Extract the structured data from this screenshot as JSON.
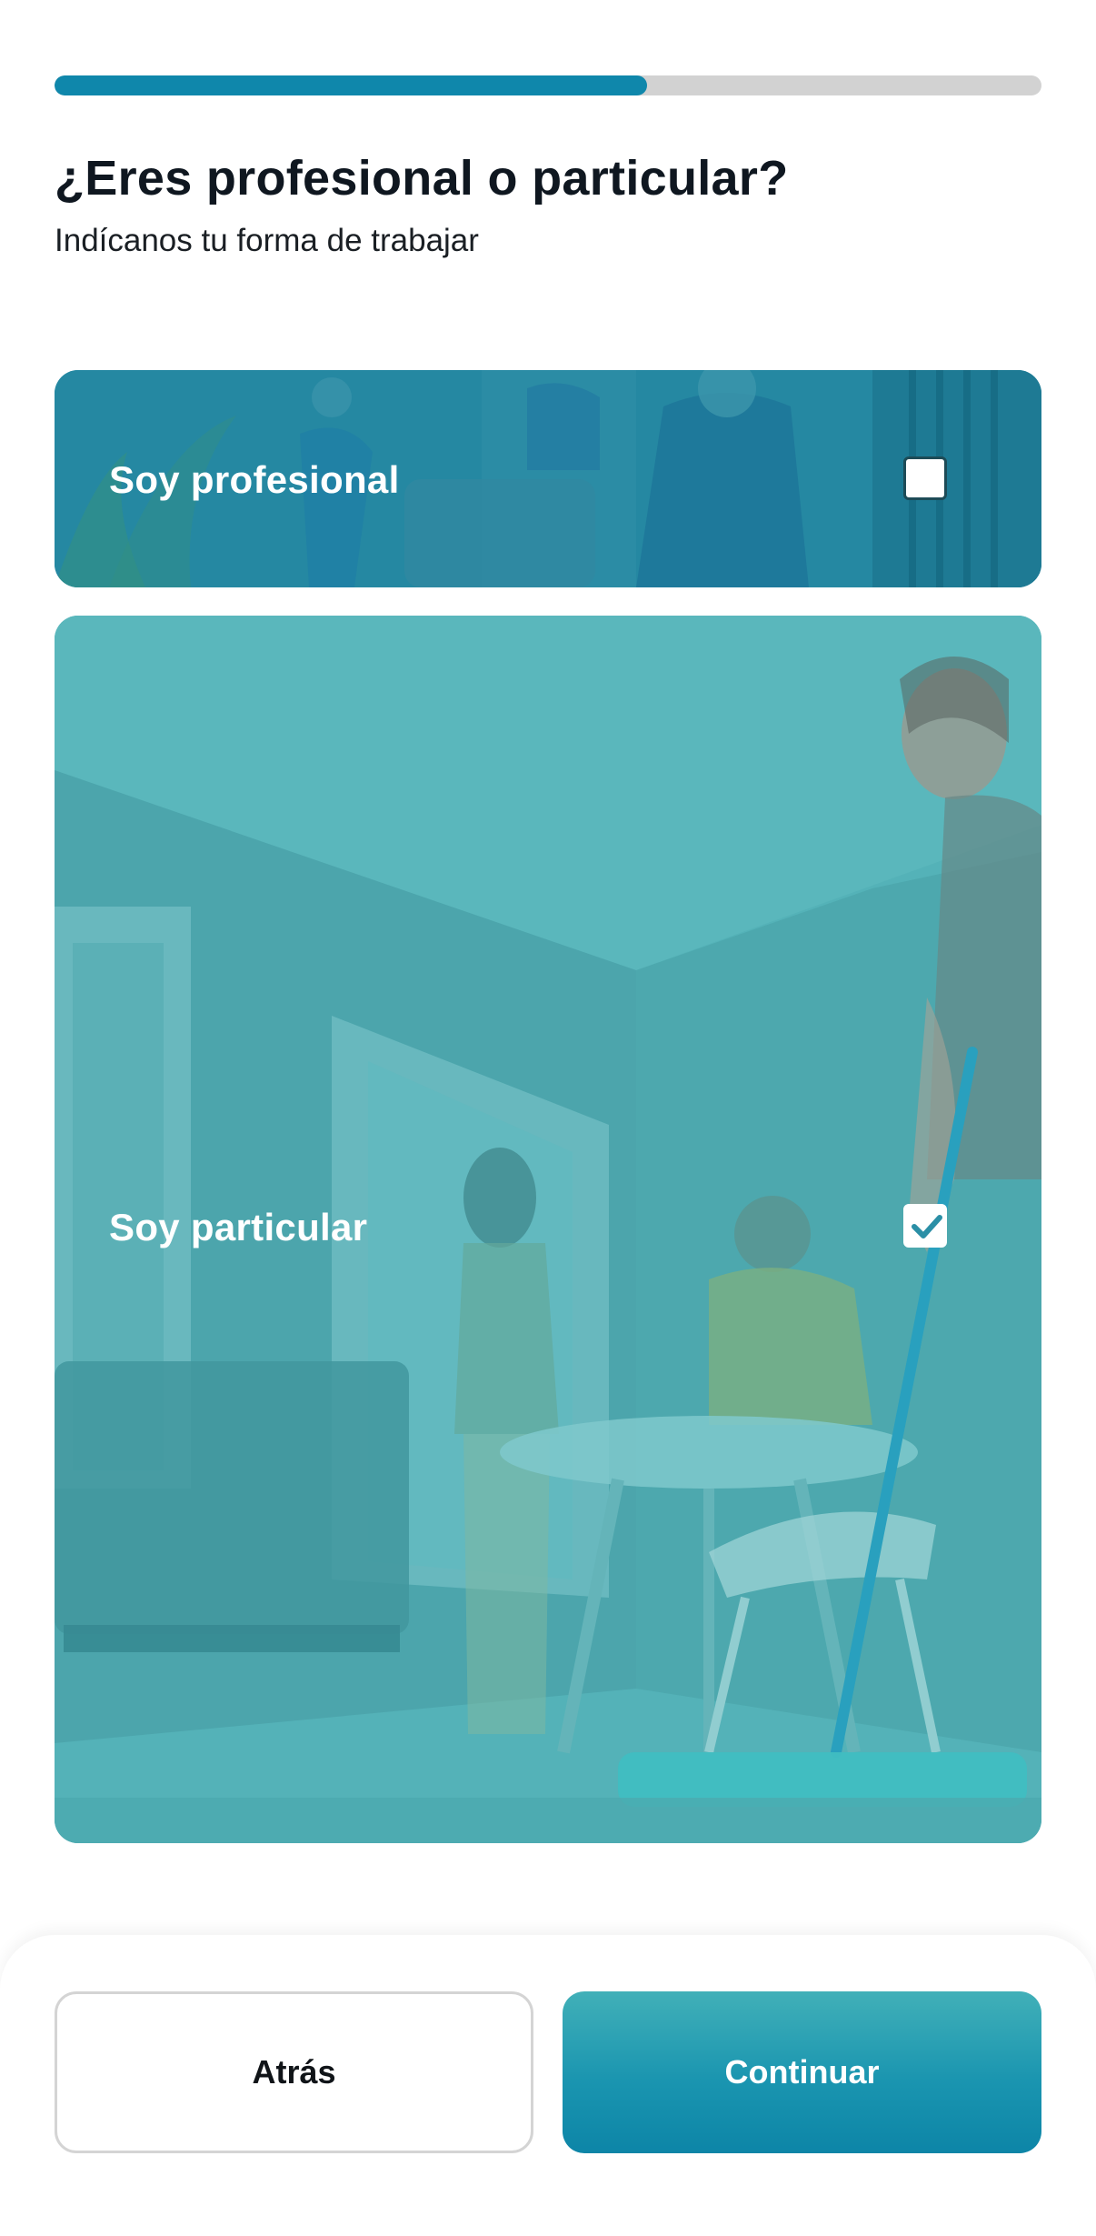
{
  "progress": {
    "value": 0.6
  },
  "header": {
    "title": "¿Eres profesional o particular?",
    "subtitle": "Indícanos tu forma de trabajar"
  },
  "options": [
    {
      "label": "Soy profesional",
      "checked": false
    },
    {
      "label": "Soy particular",
      "checked": true
    }
  ],
  "footer": {
    "back_label": "Atrás",
    "continue_label": "Continuar"
  },
  "colors": {
    "accent": "#0f87ab",
    "track": "#d2d2d2",
    "check": "#2b8fa6"
  }
}
